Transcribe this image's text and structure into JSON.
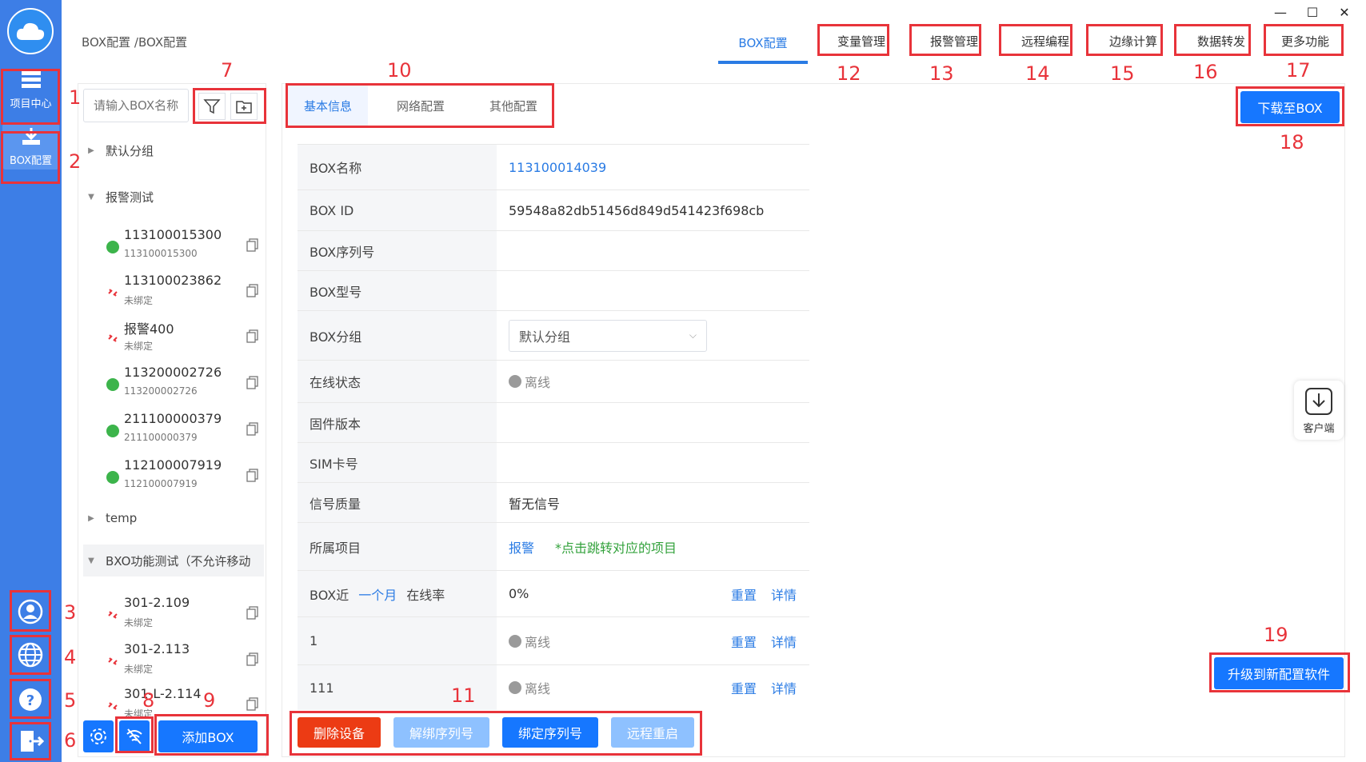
{
  "rail": {
    "items": [
      {
        "label": "项目中心"
      },
      {
        "label": "BOX配置"
      }
    ]
  },
  "header": {
    "breadcrumb": "BOX配置 /BOX配置",
    "tabs": [
      "BOX配置",
      "变量管理",
      "报警管理",
      "远程编程",
      "边缘计算",
      "数据转发",
      "更多功能"
    ],
    "window_controls": [
      "—",
      "☐",
      "✕"
    ]
  },
  "tree": {
    "search_placeholder": "请输入BOX名称",
    "groups": [
      {
        "label": "默认分组",
        "caret": "▶"
      },
      {
        "label": "报警测试",
        "caret": "▼"
      },
      {
        "label": "temp",
        "caret": "▶"
      },
      {
        "label": "BXO功能测试（不允许移动",
        "caret": "▼"
      }
    ],
    "devices": [
      {
        "name": "113100015300",
        "sub": "113100015300",
        "status": "online"
      },
      {
        "name": "113100023862",
        "sub": "未绑定",
        "status": "unbound"
      },
      {
        "name": "报警400",
        "sub": "未绑定",
        "status": "unbound"
      },
      {
        "name": "113200002726",
        "sub": "113200002726",
        "status": "online"
      },
      {
        "name": "211100000379",
        "sub": "211100000379",
        "status": "online"
      },
      {
        "name": "112100007919",
        "sub": "112100007919",
        "status": "online"
      },
      {
        "name": "301-2.109",
        "sub": "未绑定",
        "status": "unbound"
      },
      {
        "name": "301-2.113",
        "sub": "未绑定",
        "status": "unbound"
      },
      {
        "name": "301-L-2.114",
        "sub": "未绑定",
        "status": "unbound"
      }
    ],
    "add_box_label": "添加BOX"
  },
  "main": {
    "sub_tabs": [
      "基本信息",
      "网络配置",
      "其他配置"
    ],
    "download_label": "下载至BOX",
    "rows": {
      "box_name": {
        "key": "BOX名称",
        "value": "113100014039"
      },
      "box_id": {
        "key": "BOX ID",
        "value": "59548a82db51456d849d541423f698cb"
      },
      "serial": {
        "key": "BOX序列号",
        "value": ""
      },
      "model": {
        "key": "BOX型号",
        "value": ""
      },
      "group": {
        "key": "BOX分组",
        "value": "默认分组"
      },
      "online": {
        "key": "在线状态",
        "value": "离线"
      },
      "firmware": {
        "key": "固件版本",
        "value": ""
      },
      "sim": {
        "key": "SIM卡号",
        "value": ""
      },
      "signal": {
        "key": "信号质量",
        "value": "暂无信号"
      },
      "project": {
        "key": "所属项目",
        "value": "报警",
        "hint": "*点击跳转对应的项目"
      },
      "rate": {
        "key_prefix": "BOX近",
        "key_period": "一个月",
        "key_suffix": "在线率",
        "value": "0%"
      },
      "r1": {
        "key": "1",
        "value": "离线"
      },
      "r2": {
        "key": "111",
        "value": "离线"
      }
    },
    "reset_label": "重置",
    "detail_label": "详情",
    "actions": {
      "delete": "删除设备",
      "unbind": "解绑序列号",
      "bind": "绑定序列号",
      "reboot": "远程重启"
    },
    "upgrade_label": "升级到新配置软件",
    "client_label": "客户端"
  },
  "annotations": [
    "1",
    "2",
    "3",
    "4",
    "5",
    "6",
    "7",
    "8",
    "9",
    "10",
    "11",
    "12",
    "13",
    "14",
    "15",
    "16",
    "17",
    "18",
    "19"
  ],
  "colors": {
    "rail": "#3d7ee6",
    "primary": "#1677ff",
    "danger": "#ec3b14",
    "disabled": "#8ec1ff",
    "annotation": "#e8333a"
  }
}
